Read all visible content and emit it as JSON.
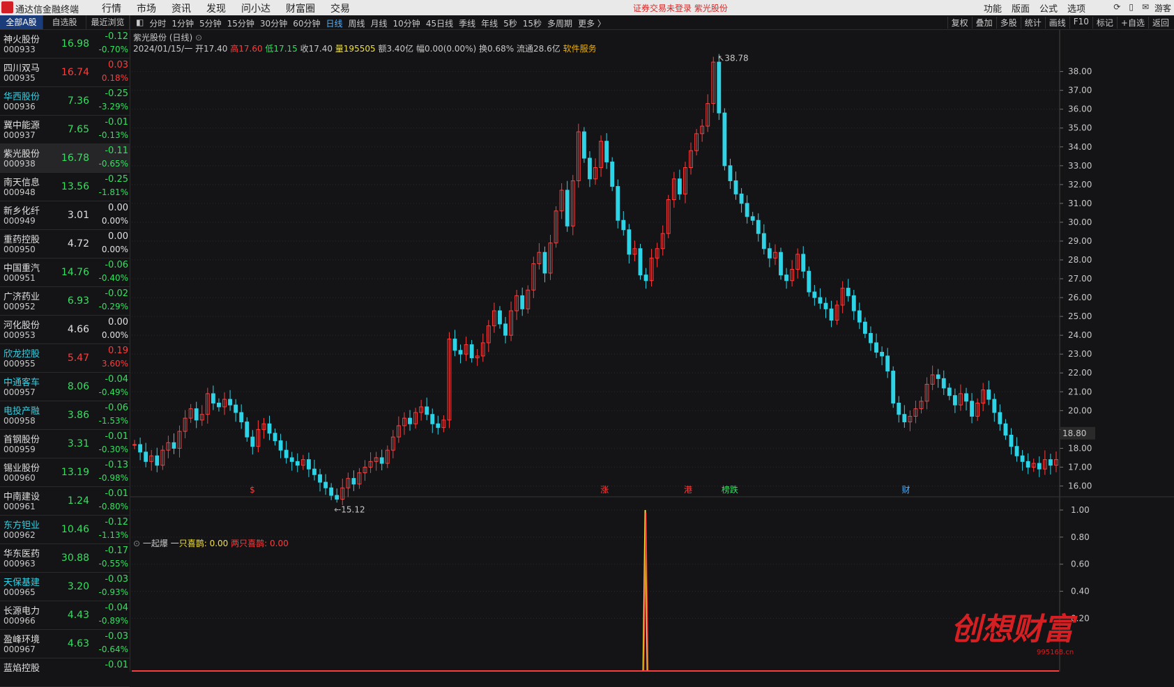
{
  "app": {
    "name": "通达信金融终端",
    "menu": [
      "行情",
      "市场",
      "资讯",
      "发现",
      "问小达",
      "财富圈",
      "交易"
    ],
    "notice": "证券交易未登录  紫光股份",
    "right_menu": [
      "功能",
      "版面",
      "公式",
      "选项"
    ],
    "user": "游客"
  },
  "sidebar": {
    "tabs": [
      "全部A股",
      "自选股",
      "最近浏览"
    ],
    "stocks": [
      {
        "name": "神火股份",
        "code": "000933",
        "price": "16.98",
        "change": "-0.12",
        "pct": "-0.70%",
        "dir": "down"
      },
      {
        "name": "四川双马",
        "code": "000935",
        "price": "16.74",
        "change": "0.03",
        "pct": "0.18%",
        "dir": "up"
      },
      {
        "name": "华西股份",
        "code": "000936",
        "price": "7.36",
        "change": "-0.25",
        "pct": "-3.29%",
        "dir": "down",
        "hl": true
      },
      {
        "name": "冀中能源",
        "code": "000937",
        "price": "7.65",
        "change": "-0.01",
        "pct": "-0.13%",
        "dir": "down"
      },
      {
        "name": "紫光股份",
        "code": "000938",
        "price": "16.78",
        "change": "-0.11",
        "pct": "-0.65%",
        "dir": "down",
        "sel": true
      },
      {
        "name": "南天信息",
        "code": "000948",
        "price": "13.56",
        "change": "-0.25",
        "pct": "-1.81%",
        "dir": "down"
      },
      {
        "name": "新乡化纤",
        "code": "000949",
        "price": "3.01",
        "change": "0.00",
        "pct": "0.00%",
        "dir": "flat"
      },
      {
        "name": "重药控股",
        "code": "000950",
        "price": "4.72",
        "change": "0.00",
        "pct": "0.00%",
        "dir": "flat"
      },
      {
        "name": "中国重汽",
        "code": "000951",
        "price": "14.76",
        "change": "-0.06",
        "pct": "-0.40%",
        "dir": "down"
      },
      {
        "name": "广济药业",
        "code": "000952",
        "price": "6.93",
        "change": "-0.02",
        "pct": "-0.29%",
        "dir": "down"
      },
      {
        "name": "河化股份",
        "code": "000953",
        "price": "4.66",
        "change": "0.00",
        "pct": "0.00%",
        "dir": "flat"
      },
      {
        "name": "欣龙控股",
        "code": "000955",
        "price": "5.47",
        "change": "0.19",
        "pct": "3.60%",
        "dir": "up",
        "hl": true
      },
      {
        "name": "中通客车",
        "code": "000957",
        "price": "8.06",
        "change": "-0.04",
        "pct": "-0.49%",
        "dir": "down",
        "hl": true
      },
      {
        "name": "电投产融",
        "code": "000958",
        "price": "3.86",
        "change": "-0.06",
        "pct": "-1.53%",
        "dir": "down",
        "hl": true
      },
      {
        "name": "首钢股份",
        "code": "000959",
        "price": "3.31",
        "change": "-0.01",
        "pct": "-0.30%",
        "dir": "down"
      },
      {
        "name": "锡业股份",
        "code": "000960",
        "price": "13.19",
        "change": "-0.13",
        "pct": "-0.98%",
        "dir": "down"
      },
      {
        "name": "中南建设",
        "code": "000961",
        "price": "1.24",
        "change": "-0.01",
        "pct": "-0.80%",
        "dir": "down"
      },
      {
        "name": "东方钽业",
        "code": "000962",
        "price": "10.46",
        "change": "-0.12",
        "pct": "-1.13%",
        "dir": "down",
        "hl": true
      },
      {
        "name": "华东医药",
        "code": "000963",
        "price": "30.88",
        "change": "-0.17",
        "pct": "-0.55%",
        "dir": "down"
      },
      {
        "name": "天保基建",
        "code": "000965",
        "price": "3.20",
        "change": "-0.03",
        "pct": "-0.93%",
        "dir": "down",
        "hl": true
      },
      {
        "name": "长源电力",
        "code": "000966",
        "price": "4.43",
        "change": "-0.04",
        "pct": "-0.89%",
        "dir": "down"
      },
      {
        "name": "盈峰环境",
        "code": "000967",
        "price": "4.63",
        "change": "-0.03",
        "pct": "-0.64%",
        "dir": "down"
      },
      {
        "name": "蓝焰控股",
        "code": "",
        "price": "",
        "change": "-0.01",
        "pct": "",
        "dir": "down"
      }
    ]
  },
  "toolbar": {
    "periods": [
      "分时",
      "1分钟",
      "5分钟",
      "15分钟",
      "30分钟",
      "60分钟",
      "日线",
      "周线",
      "月线",
      "10分钟",
      "45日线",
      "季线",
      "年线",
      "5秒",
      "15秒",
      "多周期",
      "更多 〉"
    ],
    "active_period": "日线",
    "right_tools": [
      "复权",
      "叠加",
      "多股",
      "统计",
      "画线",
      "F10",
      "标记",
      "+自选",
      "返回"
    ]
  },
  "chart_info": {
    "title": "紫光股份 (日线)",
    "date": "2024/01/15/一",
    "open": "开17.40",
    "high": "高17.60",
    "low": "低17.15",
    "close": "收17.40",
    "volume": "量195505",
    "amount": "额3.40亿",
    "amplitude": "幅0.00(0.00%)",
    "turnover": "换0.68%",
    "float_cap": "流通28.6亿",
    "sector": "软件服务"
  },
  "indicator": {
    "name": "一起爆",
    "line1": "一只喜鹊: 0.00",
    "line2": "两只喜鹊: 0.00",
    "ticks": [
      "1.00",
      "0.80",
      "0.60",
      "0.40",
      "0.20"
    ]
  },
  "watermark": {
    "text": "创想财富",
    "url": "995168.cn"
  },
  "colors": {
    "up": "#ff3c3c",
    "down": "#2fd3e6",
    "flat": "#e0e0e0",
    "yellow": "#f0e040",
    "accent": "#4fb0ff"
  },
  "chart_data": {
    "type": "candlestick",
    "ylim": [
      15.5,
      38.8
    ],
    "yticks": [
      16,
      17,
      18,
      19,
      20,
      21,
      22,
      23,
      24,
      25,
      26,
      27,
      28,
      29,
      30,
      31,
      32,
      33,
      34,
      35,
      36,
      37,
      38
    ],
    "ytick_labels": [
      "16.00",
      "17.00",
      "18.00",
      "",
      "20.00",
      "21.00",
      "22.00",
      "23.00",
      "24.00",
      "25.00",
      "26.00",
      "27.00",
      "28.00",
      "29.00",
      "30.00",
      "31.00",
      "32.00",
      "33.00",
      "34.00",
      "35.00",
      "36.00",
      "37.00",
      "38.00"
    ],
    "current_price_label": "18.80",
    "current_price": 18.8,
    "max_label": "38.78",
    "max_value": 38.78,
    "min_label": "15.12",
    "min_value": 15.12,
    "markers": [
      {
        "label": "$",
        "color": "#ff3c3c",
        "pos": 0.13
      },
      {
        "label": "涨",
        "color": "#ff3c3c",
        "pos": 0.51
      },
      {
        "label": "港",
        "color": "#ff3c3c",
        "pos": 0.6
      },
      {
        "label": "榜跌",
        "color": "#35e060",
        "pos": 0.645
      },
      {
        "label": "财",
        "color": "#4fb0ff",
        "pos": 0.835
      }
    ],
    "closes": [
      18.2,
      17.8,
      17.3,
      17.6,
      17.1,
      17.9,
      18.3,
      18.0,
      18.9,
      19.6,
      20.1,
      19.5,
      19.8,
      20.9,
      20.4,
      20.2,
      20.6,
      20.3,
      19.9,
      19.4,
      18.6,
      18.1,
      19.0,
      19.3,
      18.8,
      18.4,
      17.9,
      17.5,
      17.3,
      17.1,
      17.4,
      16.9,
      16.6,
      16.2,
      15.9,
      15.5,
      15.3,
      15.9,
      16.4,
      16.1,
      16.7,
      17.0,
      17.3,
      17.5,
      17.2,
      17.9,
      18.6,
      19.2,
      19.6,
      19.3,
      19.9,
      20.2,
      19.8,
      19.3,
      19.1,
      19.5,
      23.8,
      23.2,
      23.0,
      23.5,
      22.8,
      22.9,
      23.6,
      24.5,
      25.3,
      24.6,
      24.0,
      25.3,
      26.1,
      25.4,
      26.4,
      27.8,
      28.4,
      27.3,
      28.9,
      30.6,
      31.7,
      29.8,
      32.2,
      34.8,
      33.4,
      32.3,
      32.9,
      34.3,
      33.2,
      31.9,
      30.1,
      29.6,
      28.3,
      28.6,
      27.2,
      26.9,
      28.1,
      28.6,
      29.4,
      31.2,
      32.3,
      31.5,
      32.9,
      33.8,
      34.7,
      35.1,
      36.3,
      38.5,
      35.8,
      33.0,
      32.2,
      31.5,
      31.0,
      30.3,
      30.1,
      29.4,
      28.6,
      28.1,
      28.4,
      27.2,
      26.9,
      27.5,
      28.3,
      27.4,
      26.3,
      26.0,
      25.7,
      25.4,
      24.8,
      25.6,
      26.5,
      26.1,
      25.3,
      24.7,
      24.1,
      23.6,
      23.1,
      22.9,
      22.1,
      20.4,
      19.8,
      19.4,
      19.7,
      20.1,
      20.5,
      21.4,
      21.9,
      21.7,
      21.2,
      20.8,
      20.3,
      20.9,
      20.5,
      19.7,
      20.4,
      21.1,
      20.6,
      19.9,
      19.3,
      18.7,
      18.1,
      17.6,
      17.3,
      17.0,
      17.2,
      16.9,
      17.4,
      17.1,
      17.4
    ]
  }
}
